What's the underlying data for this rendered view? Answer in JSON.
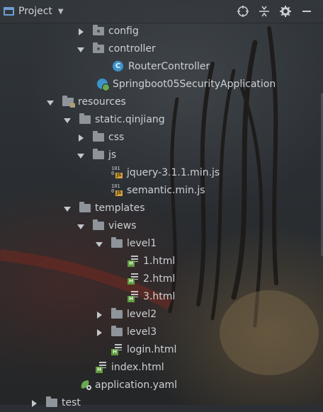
{
  "header": {
    "title": "Project",
    "tools": [
      {
        "name": "locate-icon"
      },
      {
        "name": "collapse-all-icon"
      },
      {
        "name": "settings-gear-icon"
      },
      {
        "name": "hide-panel-icon"
      }
    ]
  },
  "tree": [
    {
      "label": "config",
      "icon": "folder-package",
      "expanded": false,
      "hasArrow": true
    },
    {
      "label": "controller",
      "icon": "folder-package",
      "expanded": true,
      "hasArrow": true
    },
    {
      "label": "RouterController",
      "icon": "java-class",
      "hasArrow": false
    },
    {
      "label": "Springboot05SecurityApplication",
      "icon": "spring-boot-class",
      "hasArrow": false
    },
    {
      "label": "resources",
      "icon": "folder-resources",
      "expanded": true,
      "hasArrow": true
    },
    {
      "label": "static.qinjiang",
      "icon": "folder",
      "expanded": true,
      "hasArrow": true
    },
    {
      "label": "css",
      "icon": "folder",
      "expanded": false,
      "hasArrow": true
    },
    {
      "label": "js",
      "icon": "folder",
      "expanded": true,
      "hasArrow": true
    },
    {
      "label": "jquery-3.1.1.min.js",
      "icon": "js-file",
      "hasArrow": false
    },
    {
      "label": "semantic.min.js",
      "icon": "js-file",
      "hasArrow": false
    },
    {
      "label": "templates",
      "icon": "folder",
      "expanded": true,
      "hasArrow": true
    },
    {
      "label": "views",
      "icon": "folder",
      "expanded": true,
      "hasArrow": true
    },
    {
      "label": "level1",
      "icon": "folder",
      "expanded": true,
      "hasArrow": true
    },
    {
      "label": "1.html",
      "icon": "html-file",
      "hasArrow": false
    },
    {
      "label": "2.html",
      "icon": "html-file",
      "hasArrow": false
    },
    {
      "label": "3.html",
      "icon": "html-file",
      "hasArrow": false
    },
    {
      "label": "level2",
      "icon": "folder",
      "expanded": false,
      "hasArrow": true
    },
    {
      "label": "level3",
      "icon": "folder",
      "expanded": false,
      "hasArrow": true
    },
    {
      "label": "login.html",
      "icon": "html-file",
      "hasArrow": false
    },
    {
      "label": "index.html",
      "icon": "html-file",
      "hasArrow": false
    },
    {
      "label": "application.yaml",
      "icon": "yaml-file",
      "hasArrow": false
    },
    {
      "label": "test",
      "icon": "folder",
      "expanded": false,
      "hasArrow": true
    }
  ],
  "icon_badges": {
    "java_class_letter": "C",
    "js_binary": "101\n0",
    "js_tag": "JS",
    "html_tag": "H"
  },
  "colors": {
    "folder": "#8e9499",
    "class_icon": "#3e93c9",
    "js_tag": "#d4a23c",
    "html_tag": "#5f9a3e",
    "yaml_leaf": "#6aa84f"
  }
}
